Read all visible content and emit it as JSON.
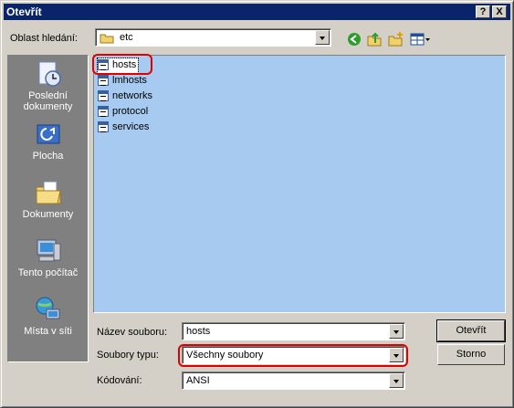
{
  "window": {
    "title": "Otevřít",
    "help_btn": "?",
    "close_btn": "X"
  },
  "lookin": {
    "label": "Oblast hledání:",
    "value": "etc"
  },
  "places": [
    {
      "id": "recent",
      "label1": "Poslední",
      "label2": "dokumenty"
    },
    {
      "id": "desktop",
      "label1": "Plocha"
    },
    {
      "id": "documents",
      "label1": "Dokumenty"
    },
    {
      "id": "computer",
      "label1": "Tento počítač"
    },
    {
      "id": "network",
      "label1": "Místa v síti"
    }
  ],
  "files": [
    "hosts",
    "lmhosts",
    "networks",
    "protocol",
    "services"
  ],
  "filename": {
    "label": "Název souboru:",
    "value": "hosts"
  },
  "filetype": {
    "label": "Soubory typu:",
    "value": "Všechny soubory"
  },
  "encoding": {
    "label": "Kódování:",
    "value": "ANSI"
  },
  "buttons": {
    "open": "Otevřít",
    "cancel": "Storno"
  },
  "colors": {
    "titlebar": "#0a246a",
    "dialog": "#d4d0c8",
    "list_bg": "#a6caf0",
    "highlight": "#e00000"
  }
}
